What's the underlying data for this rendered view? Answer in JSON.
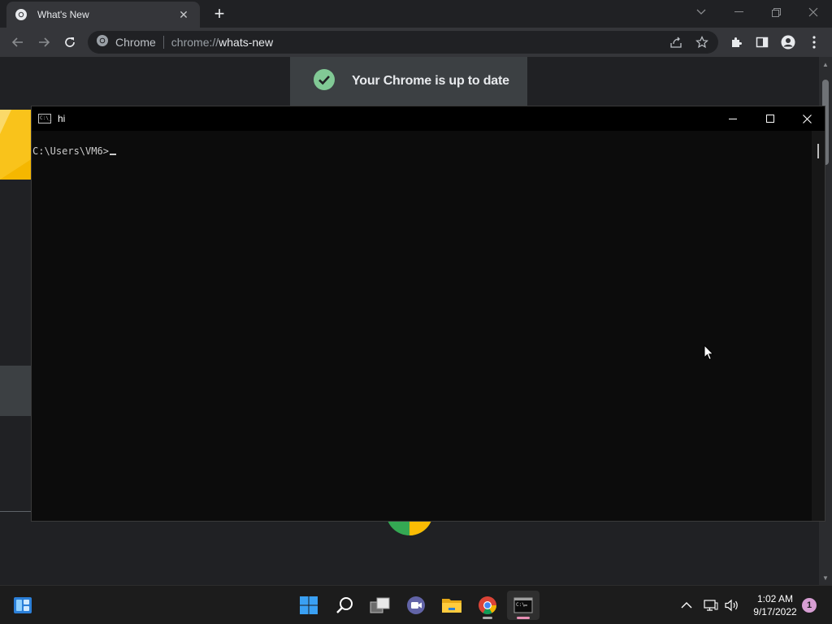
{
  "browser": {
    "tab": {
      "title": "What's New",
      "favicon": "chrome-icon"
    },
    "new_tab_label": "+",
    "omnibox": {
      "chip": "Chrome",
      "url_scheme": "chrome://",
      "url_host": "whats-new"
    }
  },
  "page": {
    "toast": {
      "text": "Your Chrome is up to date",
      "icon": "check-circle-icon",
      "icon_color": "#81c995"
    }
  },
  "console": {
    "title": "hi",
    "icon_text": "C:\\_",
    "prompt": "C:\\Users\\VM6>"
  },
  "taskbar": {
    "apps": [
      "start-icon",
      "search-icon",
      "task-view-icon",
      "chat-icon",
      "file-explorer-icon",
      "chrome-icon",
      "terminal-icon"
    ],
    "clock": {
      "time": "1:02 AM",
      "date": "9/17/2022"
    },
    "notification_count": "1"
  },
  "colors": {
    "accent_pink": "#e88fb5",
    "chrome_yellow": "#f9c31b"
  }
}
